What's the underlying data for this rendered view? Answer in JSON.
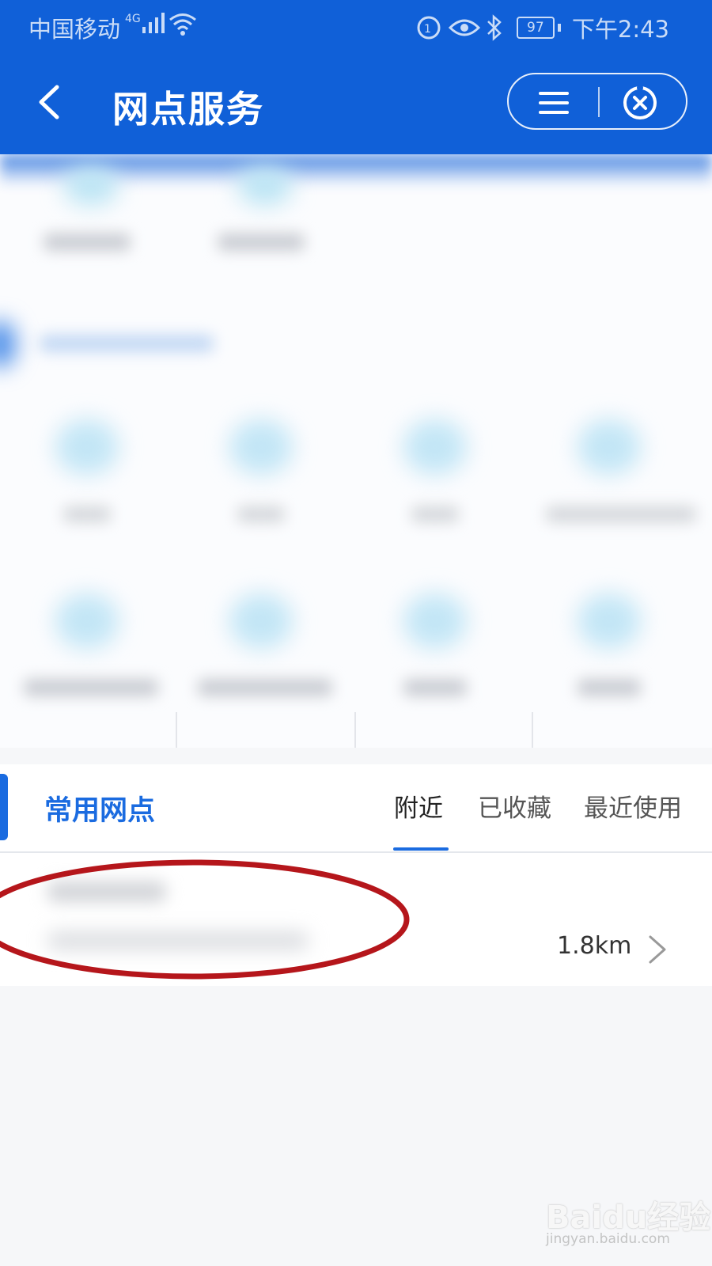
{
  "status_bar": {
    "carrier": "中国移动",
    "network": "4G",
    "battery": "97",
    "time": "下午2:43"
  },
  "nav": {
    "title": "网点服务"
  },
  "section": {
    "title": "常用网点",
    "tabs": [
      "附近",
      "已收藏",
      "最近使用"
    ],
    "active_tab": "附近"
  },
  "branch_list": [
    {
      "distance": "1.8km"
    }
  ],
  "watermark": {
    "logo": "Baidu经验",
    "url": "jingyan.baidu.com"
  },
  "colors": {
    "header_blue": "#1060d8",
    "accent_blue": "#1a6be0",
    "annotation_red": "#b5161b"
  }
}
